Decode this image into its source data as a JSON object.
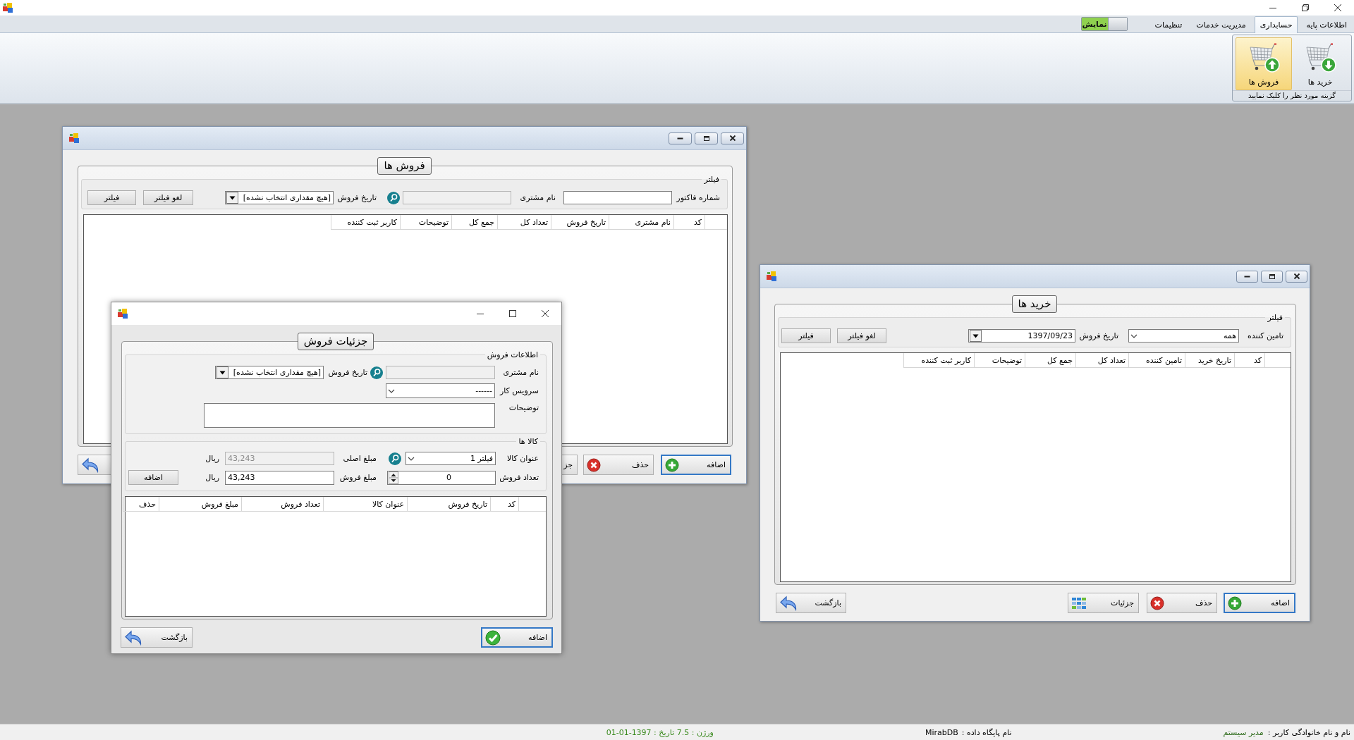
{
  "ribbon": {
    "tabs": [
      {
        "label": "اطلاعات پایه",
        "selected": false
      },
      {
        "label": "حسابداری",
        "selected": true
      },
      {
        "label": "مدیریت خدمات",
        "selected": false
      },
      {
        "label": "تنظیمات",
        "selected": false
      }
    ],
    "display_toggle": {
      "label": "نمایش",
      "on": true
    },
    "group": {
      "buttons": [
        {
          "label": "خرید ها",
          "kind": "purchases",
          "selected": false
        },
        {
          "label": "فروش ها",
          "kind": "sales",
          "selected": true
        }
      ],
      "caption": "گزینه مورد نظر را کلیک نمایید"
    }
  },
  "sales_window": {
    "title": "فروش ها",
    "filter": {
      "legend": "فیلتر",
      "invoice_label": "شماره فاکتور",
      "customer_label": "نام مشتری",
      "customer_disabled": true,
      "date_label": "تاریخ فروش",
      "date_value": "[هیچ مقداری انتخاب نشده]",
      "clear_button": "لغو فیلتر",
      "filter_button": "فیلتر"
    },
    "columns": [
      "کد",
      "نام مشتری",
      "تاریخ فروش",
      "تعداد کل",
      "جمع کل",
      "توضیحات",
      "کاربر ثبت کننده"
    ],
    "buttons": [
      {
        "kind": "add",
        "label": "اضافه",
        "focused": true
      },
      {
        "kind": "delete",
        "label": "حذف",
        "focused": false
      },
      {
        "kind": "details",
        "label": "جز",
        "focused": false
      },
      {
        "kind": "back",
        "focused": false
      }
    ]
  },
  "purchases_window": {
    "title": "خرید ها",
    "filter": {
      "legend": "فیلتر",
      "supplier_label": "تامین کننده",
      "supplier_value": "همه",
      "date_label": "تاریخ فروش",
      "date_value": "1397/09/23",
      "clear_button": "لغو فیلتر",
      "filter_button": "فیلتر"
    },
    "columns": [
      "کد",
      "تاریخ خرید",
      "تامین کننده",
      "تعداد کل",
      "جمع کل",
      "توضیحات",
      "کاربر ثبت کننده"
    ],
    "buttons": [
      {
        "kind": "add",
        "label": "اضافه",
        "focused": true
      },
      {
        "kind": "delete",
        "label": "حذف",
        "focused": false
      },
      {
        "kind": "details",
        "label": "جزئیات",
        "focused": false
      },
      {
        "kind": "back",
        "label": "بازگشت",
        "focused": false
      }
    ]
  },
  "detail_window": {
    "title": "جزئیات فروش",
    "sale_info": {
      "legend": "اطلاعات فروش",
      "customer_label": "نام مشتری",
      "customer_disabled": true,
      "date_label": "تاریخ فروش",
      "date_value": "[هیچ مقداری انتخاب نشده]",
      "service_label": "سرویس کار",
      "service_value": "------",
      "notes_label": "توضیحات"
    },
    "items": {
      "legend": "کالا ها",
      "product_label": "عنوان کالا",
      "product_value": "فیلتر 1",
      "base_price_label": "مبلغ اصلی",
      "base_price_value": "43,243",
      "base_price_disabled": true,
      "base_price_unit": "ریال",
      "quantity_label": "تعداد فروش",
      "quantity_value": "0",
      "sale_price_label": "مبلغ فروش",
      "sale_price_value": "43,243",
      "sale_price_unit": "ریال",
      "add_button": "اضافه"
    },
    "columns": [
      "کد",
      "تاریخ فروش",
      "عنوان کالا",
      "تعداد فروش",
      "مبلغ فروش",
      "حذف"
    ],
    "buttons": [
      {
        "kind": "confirm",
        "label": "اضافه",
        "focused": true
      },
      {
        "kind": "back",
        "label": "بازگشت",
        "focused": false
      }
    ]
  },
  "status_bar": {
    "user_label": "نام و نام خانوادگی کاربر :",
    "user_name": "مدیر سیستم",
    "database_label": "نام پایگاه داده :",
    "database_name": "MirabDB",
    "version_text": "ورژن : 7.5  تاریخ : 1397-01-01"
  }
}
